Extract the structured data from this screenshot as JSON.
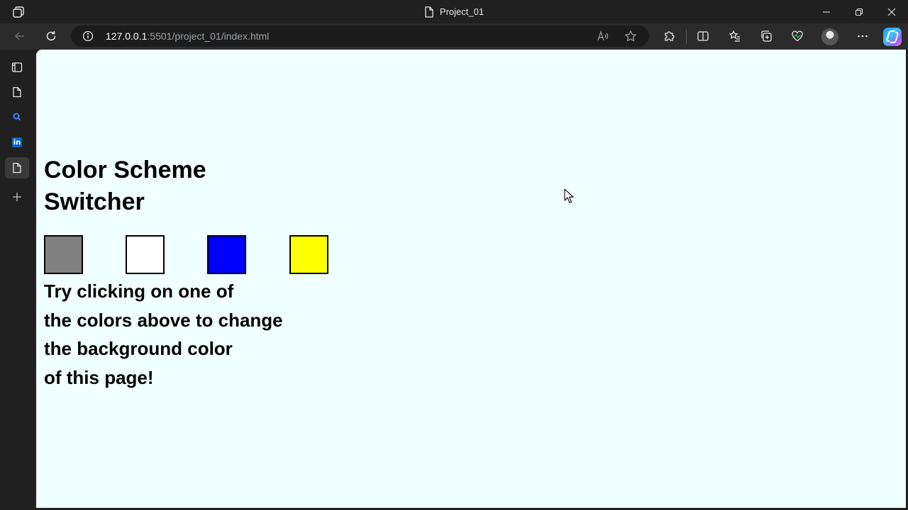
{
  "window": {
    "tab_title": "Project_01"
  },
  "addressbar": {
    "url_host": "127.0.0.1",
    "url_rest": ":5501/project_01/index.html"
  },
  "page": {
    "title_lines": [
      "Color Scheme",
      "Switcher"
    ],
    "swatches": [
      {
        "color": "#808080"
      },
      {
        "color": "#ffffff"
      },
      {
        "color": "#0000ff"
      },
      {
        "color": "#ffff00"
      }
    ],
    "instruction_lines": [
      "Try clicking on one of",
      "the colors above to change",
      "the background color",
      "of this page!"
    ],
    "background_color": "#f0ffff"
  },
  "theme": {
    "chrome_bg": "#202020",
    "toolbar_bg": "#2b2b2b",
    "linkedin_blue": "#0a66c2"
  }
}
